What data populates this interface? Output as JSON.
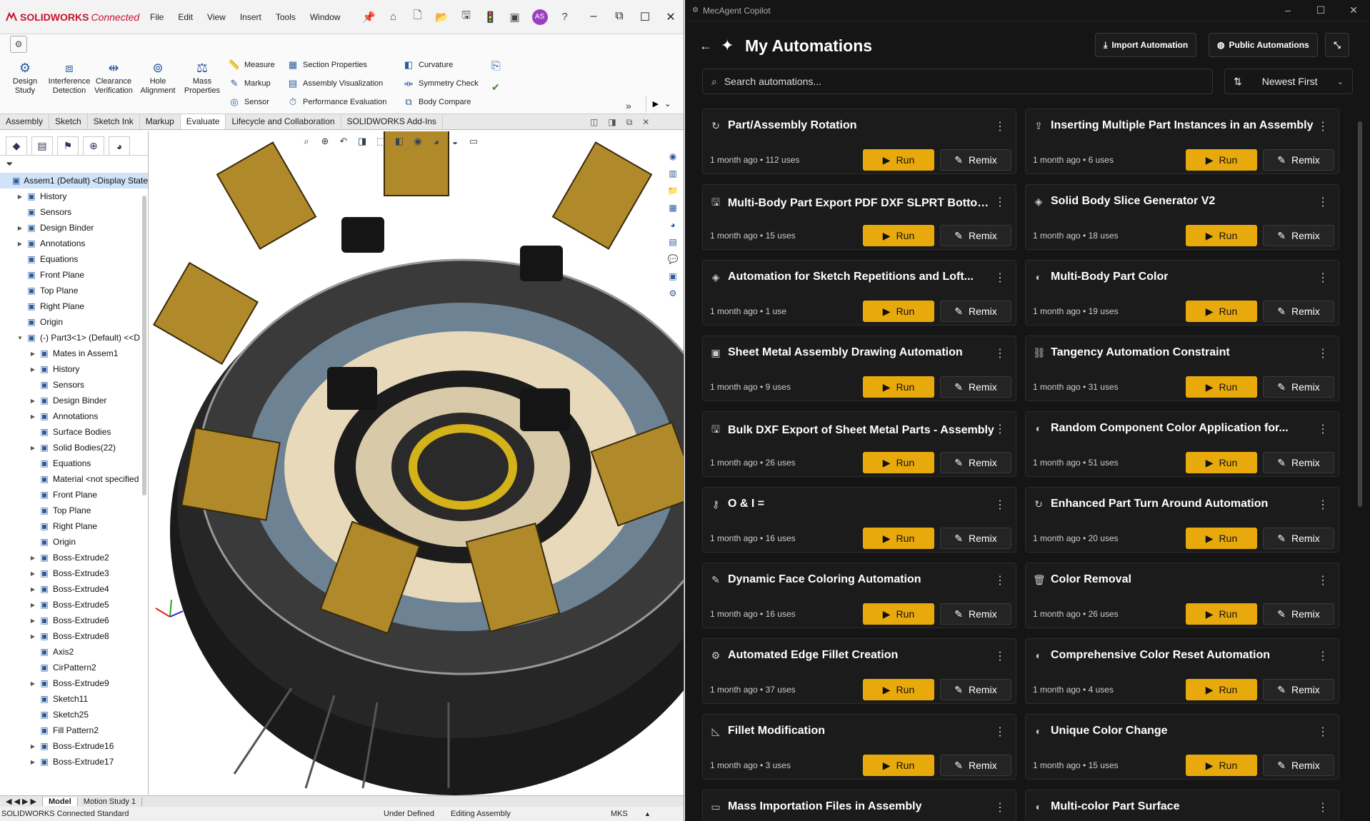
{
  "solidworks": {
    "logo_brand": "SOLIDWORKS",
    "logo_suffix": "Connected",
    "menus": [
      "File",
      "Edit",
      "View",
      "Insert",
      "Tools",
      "Window"
    ],
    "user_initials": "AS",
    "big_buttons": [
      {
        "label": "Design Study",
        "icon": "design-study-icon"
      },
      {
        "label": "Interference Detection",
        "icon": "interference-icon"
      },
      {
        "label": "Clearance Verification",
        "icon": "clearance-icon"
      },
      {
        "label": "Hole Alignment",
        "icon": "hole-alignment-icon"
      },
      {
        "label": "Mass Properties",
        "icon": "mass-properties-icon"
      }
    ],
    "small_col1": [
      "Measure",
      "Markup",
      "Sensor"
    ],
    "small_col2": [
      "Section Properties",
      "Assembly Visualization",
      "Performance Evaluation"
    ],
    "small_col3": [
      "Curvature",
      "Symmetry Check",
      "Body Compare"
    ],
    "cm_tabs": [
      "Assembly",
      "Sketch",
      "Sketch Ink",
      "Markup",
      "Evaluate",
      "Lifecycle and Collaboration",
      "SOLIDWORKS Add-Ins"
    ],
    "active_tab": "Evaluate",
    "tree_nodes": [
      {
        "label": "Assem1 (Default) <Display State",
        "level": 0,
        "arrow": "",
        "sel": true
      },
      {
        "label": "History",
        "level": 1,
        "arrow": "▶"
      },
      {
        "label": "Sensors",
        "level": 1,
        "arrow": ""
      },
      {
        "label": "Design Binder",
        "level": 1,
        "arrow": "▶"
      },
      {
        "label": "Annotations",
        "level": 1,
        "arrow": "▶"
      },
      {
        "label": "Equations",
        "level": 1,
        "arrow": ""
      },
      {
        "label": "Front Plane",
        "level": 1,
        "arrow": ""
      },
      {
        "label": "Top Plane",
        "level": 1,
        "arrow": ""
      },
      {
        "label": "Right Plane",
        "level": 1,
        "arrow": ""
      },
      {
        "label": "Origin",
        "level": 1,
        "arrow": ""
      },
      {
        "label": "(-) Part3<1> (Default) <<D",
        "level": 1,
        "arrow": "▼"
      },
      {
        "label": "Mates in Assem1",
        "level": 2,
        "arrow": "▶"
      },
      {
        "label": "History",
        "level": 2,
        "arrow": "▶"
      },
      {
        "label": "Sensors",
        "level": 2,
        "arrow": ""
      },
      {
        "label": "Design Binder",
        "level": 2,
        "arrow": "▶"
      },
      {
        "label": "Annotations",
        "level": 2,
        "arrow": "▶"
      },
      {
        "label": "Surface Bodies",
        "level": 2,
        "arrow": ""
      },
      {
        "label": "Solid Bodies(22)",
        "level": 2,
        "arrow": "▶"
      },
      {
        "label": "Equations",
        "level": 2,
        "arrow": ""
      },
      {
        "label": "Material <not specified",
        "level": 2,
        "arrow": ""
      },
      {
        "label": "Front Plane",
        "level": 2,
        "arrow": ""
      },
      {
        "label": "Top Plane",
        "level": 2,
        "arrow": ""
      },
      {
        "label": "Right Plane",
        "level": 2,
        "arrow": ""
      },
      {
        "label": "Origin",
        "level": 2,
        "arrow": ""
      },
      {
        "label": "Boss-Extrude2",
        "level": 2,
        "arrow": "▶"
      },
      {
        "label": "Boss-Extrude3",
        "level": 2,
        "arrow": "▶"
      },
      {
        "label": "Boss-Extrude4",
        "level": 2,
        "arrow": "▶"
      },
      {
        "label": "Boss-Extrude5",
        "level": 2,
        "arrow": "▶"
      },
      {
        "label": "Boss-Extrude6",
        "level": 2,
        "arrow": "▶"
      },
      {
        "label": "Boss-Extrude8",
        "level": 2,
        "arrow": "▶"
      },
      {
        "label": "Axis2",
        "level": 2,
        "arrow": ""
      },
      {
        "label": "CirPattern2",
        "level": 2,
        "arrow": ""
      },
      {
        "label": "Boss-Extrude9",
        "level": 2,
        "arrow": "▶"
      },
      {
        "label": "Sketch11",
        "level": 2,
        "arrow": ""
      },
      {
        "label": "Sketch25",
        "level": 2,
        "arrow": ""
      },
      {
        "label": "Fill Pattern2",
        "level": 2,
        "arrow": ""
      },
      {
        "label": "Boss-Extrude16",
        "level": 2,
        "arrow": "▶"
      },
      {
        "label": "Boss-Extrude17",
        "level": 2,
        "arrow": "▶"
      }
    ],
    "bottom_tabs": [
      "Model",
      "Motion Study 1"
    ],
    "status": {
      "left": "SOLIDWORKS Connected Standard",
      "mid1": "Under Defined",
      "mid2": "Editing Assembly",
      "units": "MKS"
    }
  },
  "mecagent": {
    "window_title": "MecAgent Copilot",
    "page_title": "My Automations",
    "import_label": "Import Automation",
    "public_label": "Public Automations",
    "search_placeholder": "Search automations...",
    "sort_label": "Newest First",
    "run_label": "Run",
    "remix_label": "Remix",
    "accent": "#e8a90c",
    "cards": [
      {
        "title": "Part/Assembly Rotation",
        "meta": "1 month ago • 112 uses",
        "icon": "↻"
      },
      {
        "title": "Inserting Multiple Part Instances in an Assembly",
        "meta": "1 month ago • 6 uses",
        "icon": "⇪"
      },
      {
        "title": "Multi-Body Part Export PDF DXF SLPRT Bottom...",
        "meta": "1 month ago • 15 uses",
        "icon": "🖫"
      },
      {
        "title": "Solid Body Slice Generator V2",
        "meta": "1 month ago • 18 uses",
        "icon": "◈"
      },
      {
        "title": "Automation for Sketch Repetitions and Loft...",
        "meta": "1 month ago • 1 use",
        "icon": "◈"
      },
      {
        "title": "Multi-Body Part Color",
        "meta": "1 month ago • 19 uses",
        "icon": "◐"
      },
      {
        "title": "Sheet Metal Assembly Drawing Automation",
        "meta": "1 month ago • 9 uses",
        "icon": "▣"
      },
      {
        "title": "Tangency Automation Constraint",
        "meta": "1 month ago • 31 uses",
        "icon": "⛓"
      },
      {
        "title": "Bulk DXF Export of Sheet Metal Parts - Assembly",
        "meta": "1 month ago • 26 uses",
        "icon": "🖫"
      },
      {
        "title": "Random Component Color Application for...",
        "meta": "1 month ago • 51 uses",
        "icon": "◐"
      },
      {
        "title": "O & I =",
        "meta": "1 month ago • 16 uses",
        "icon": "⚷"
      },
      {
        "title": "Enhanced Part Turn Around Automation",
        "meta": "1 month ago • 20 uses",
        "icon": "↻"
      },
      {
        "title": "Dynamic Face Coloring Automation",
        "meta": "1 month ago • 16 uses",
        "icon": "✎"
      },
      {
        "title": "Color Removal",
        "meta": "1 month ago • 26 uses",
        "icon": "🗑"
      },
      {
        "title": "Automated Edge Fillet Creation",
        "meta": "1 month ago • 37 uses",
        "icon": "⚙"
      },
      {
        "title": "Comprehensive Color Reset Automation",
        "meta": "1 month ago • 4 uses",
        "icon": "◐"
      },
      {
        "title": "Fillet Modification",
        "meta": "1 month ago • 3 uses",
        "icon": "◺"
      },
      {
        "title": "Unique Color Change",
        "meta": "1 month ago • 15 uses",
        "icon": "◐"
      },
      {
        "title": "Mass Importation Files in Assembly",
        "meta": "",
        "icon": "▭"
      },
      {
        "title": "Multi-color Part Surface",
        "meta": "",
        "icon": "◐"
      }
    ]
  }
}
